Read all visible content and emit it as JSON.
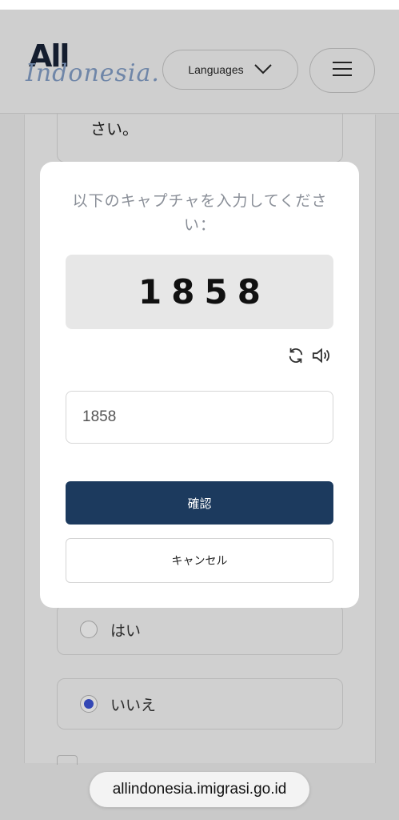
{
  "header": {
    "logo_all": "All",
    "logo_indonesia": "Indonesia.",
    "language_button": "Languages"
  },
  "question": {
    "text_tail": "さい。"
  },
  "options": [
    {
      "label": "はい",
      "selected": false
    },
    {
      "label": "いいえ",
      "selected": true
    }
  ],
  "modal": {
    "title": "以下のキャプチャを入力してください：",
    "captcha_code": "1858",
    "input_value": "1858",
    "confirm_label": "確認",
    "cancel_label": "キャンセル"
  },
  "browser": {
    "url": "allindonesia.imigrasi.go.id"
  },
  "colors": {
    "primary": "#1c3a5e",
    "radio_selected": "#3347b5"
  }
}
